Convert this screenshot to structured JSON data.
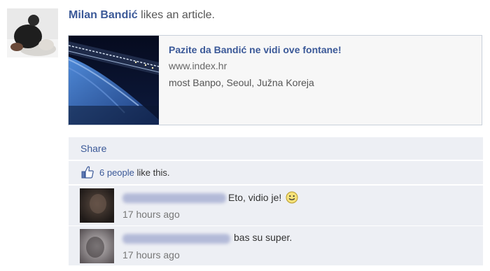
{
  "story": {
    "author": "Milan Bandić",
    "verb": "likes an article."
  },
  "article": {
    "title": "Pazite da Bandić ne vidi ove fontane!",
    "domain": "www.index.hr",
    "caption": "most Banpo, Seoul, Južna Koreja"
  },
  "actions": {
    "share_label": "Share"
  },
  "likes": {
    "people_link": "6 people",
    "suffix": " like this."
  },
  "comments": [
    {
      "text": "Eto, vidio je!",
      "time": "17 hours ago",
      "emoticon": "smiley-icon"
    },
    {
      "text": "bas su super.",
      "time": "17 hours ago"
    }
  ],
  "colors": {
    "link_blue": "#3b5998",
    "panel_bg": "#edeff4",
    "article_border": "#c9d0da"
  }
}
